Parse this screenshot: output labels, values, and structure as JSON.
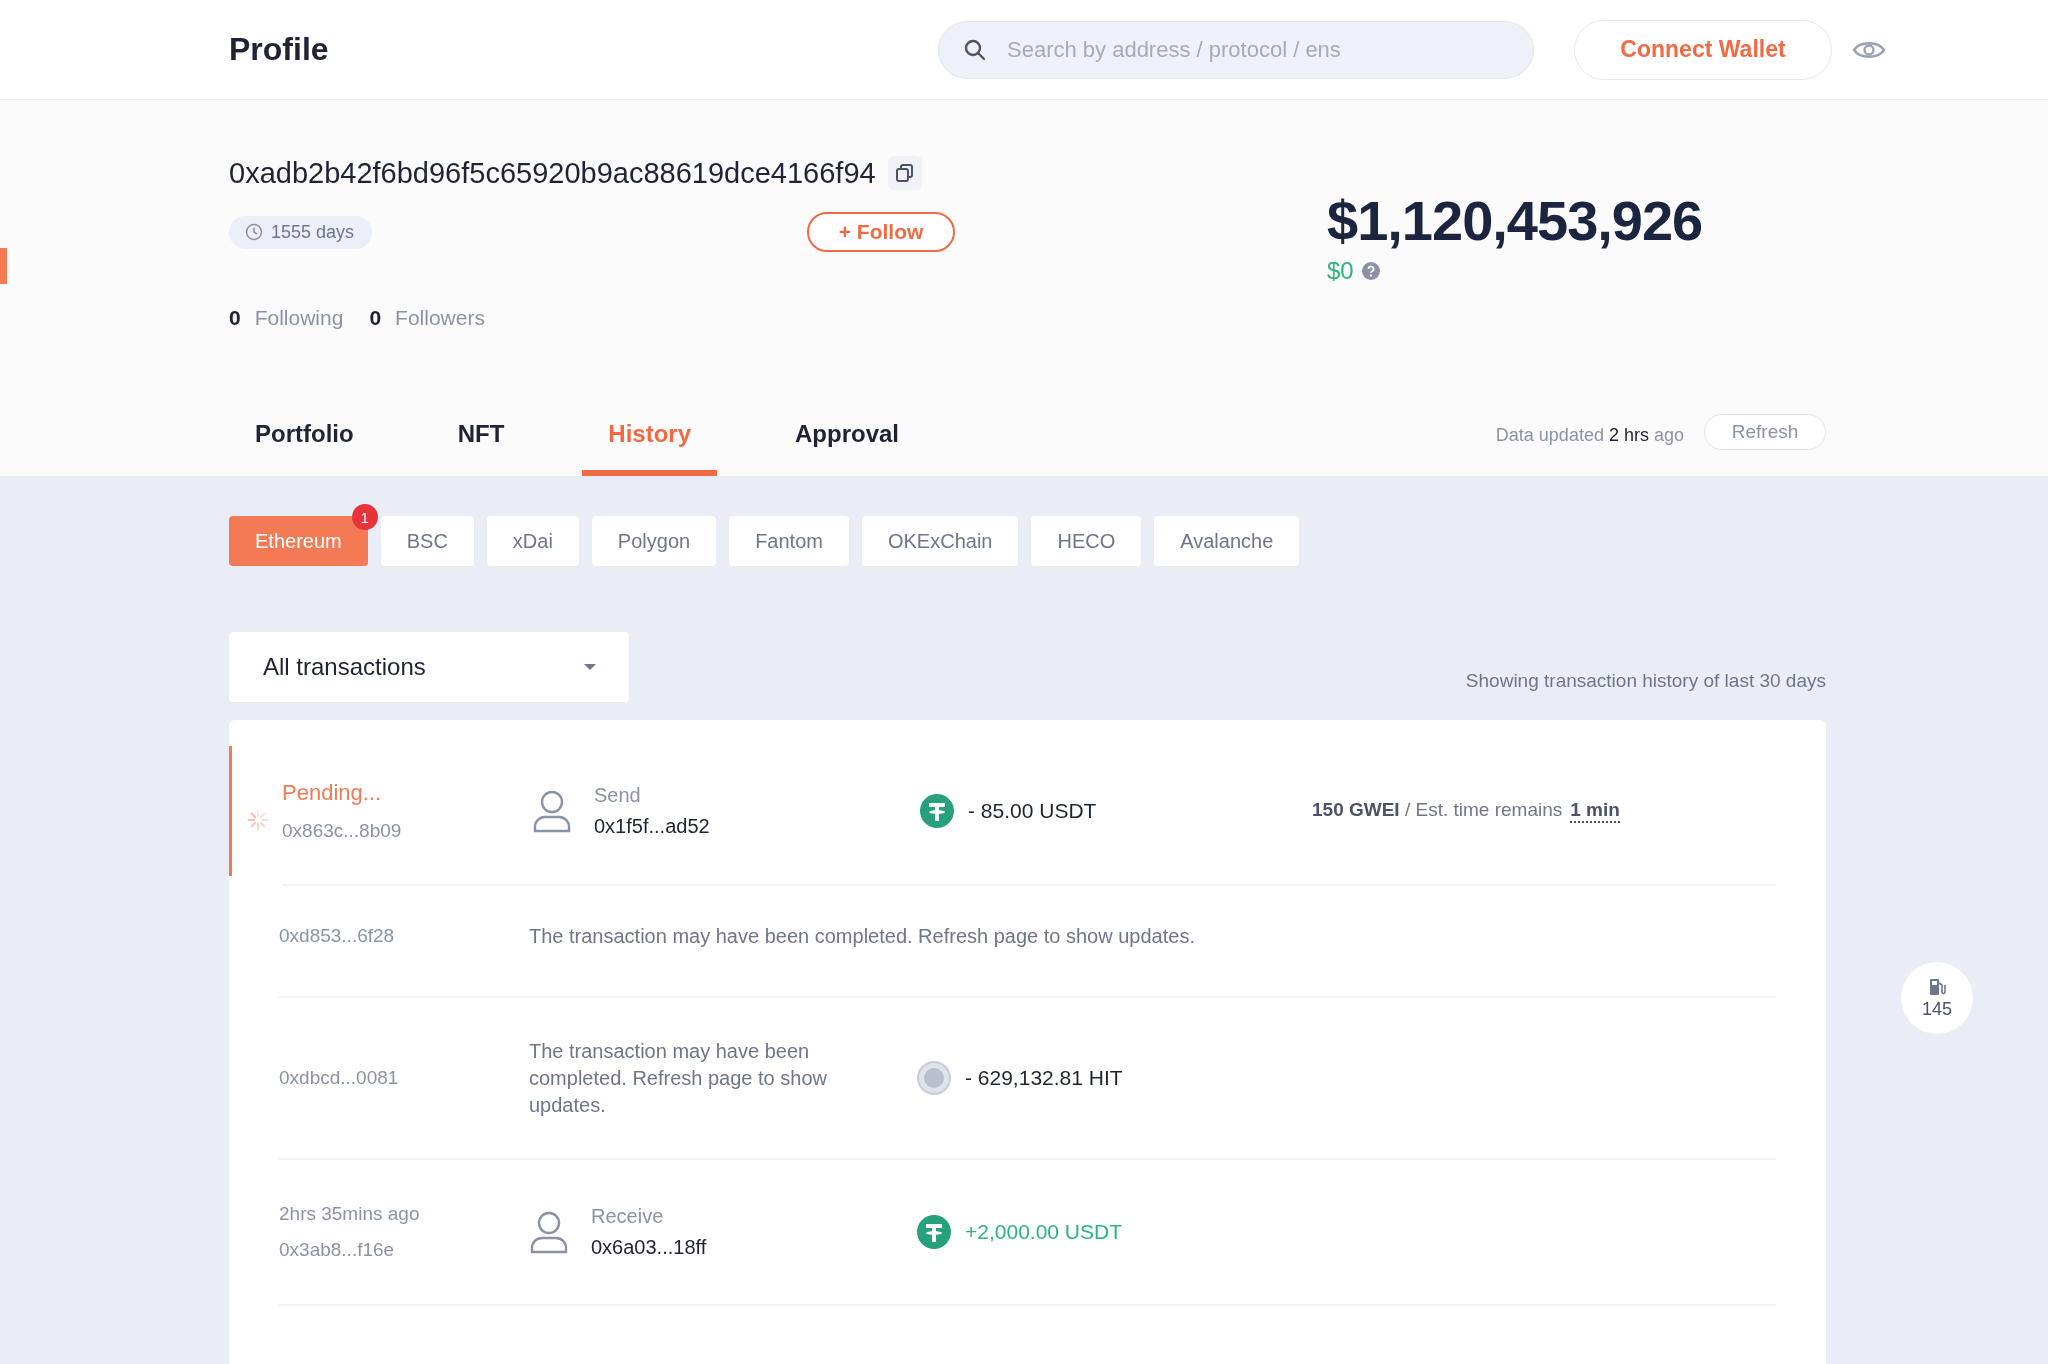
{
  "header": {
    "title": "Profile",
    "search": {
      "placeholder": "Search by address / protocol / ens"
    },
    "connect_button": "Connect Wallet"
  },
  "profile": {
    "address": "0xadb2b42f6bd96f5c65920b9ac88619dce4166f94",
    "age": "1555 days",
    "follow_button": "+ Follow",
    "following": {
      "count": "0",
      "label": "Following"
    },
    "followers": {
      "count": "0",
      "label": "Followers"
    }
  },
  "balance": {
    "total": "$1,120,453,926",
    "change": "$0"
  },
  "tabs": [
    {
      "label": "Portfolio",
      "selected": false
    },
    {
      "label": "NFT",
      "selected": false
    },
    {
      "label": "History",
      "selected": true
    },
    {
      "label": "Approval",
      "selected": false
    }
  ],
  "data_updated": "Data updated **2 hrs** ago",
  "refresh_button": "Refresh",
  "chains": [
    {
      "label": "Ethereum",
      "selected": true,
      "badge": "1"
    },
    {
      "label": "BSC",
      "selected": false
    },
    {
      "label": "xDai",
      "selected": false
    },
    {
      "label": "Polygon",
      "selected": false
    },
    {
      "label": "Fantom",
      "selected": false
    },
    {
      "label": "OKExChain",
      "selected": false
    },
    {
      "label": "HECO",
      "selected": false
    },
    {
      "label": "Avalanche",
      "selected": false
    }
  ],
  "filter": {
    "value": "All transactions"
  },
  "history_note": "Showing transaction history of last 30 days",
  "transactions": [
    {
      "kind": "pending",
      "status": "Pending...",
      "hash": "0x863c...8b09",
      "action": "Send",
      "address": "0x1f5f...ad52",
      "token": {
        "kind": "tether"
      },
      "amount": "- 85.00 USDT",
      "incoming": false,
      "gas": "**150 GWEI** / Est. time remains",
      "eta": "1 min"
    },
    {
      "kind": "notice",
      "hash": "0xd853...6f28",
      "message": "The transaction may have been completed. Refresh page to show updates."
    },
    {
      "kind": "notice",
      "hash": "0xdbcd...0081",
      "message": "The transaction may have been completed. Refresh page to show updates.",
      "token": {
        "kind": "unknown"
      },
      "amount": "- 629,132.81 HIT",
      "incoming": false
    },
    {
      "kind": "transfer",
      "time": "2hrs 35mins ago",
      "hash": "0x3ab8...f16e",
      "action": "Receive",
      "address": "0x6a03...18ff",
      "token": {
        "kind": "tether"
      },
      "amount": "+2,000.00 USDT",
      "incoming": true
    }
  ],
  "gas_widget": {
    "value": "145"
  }
}
